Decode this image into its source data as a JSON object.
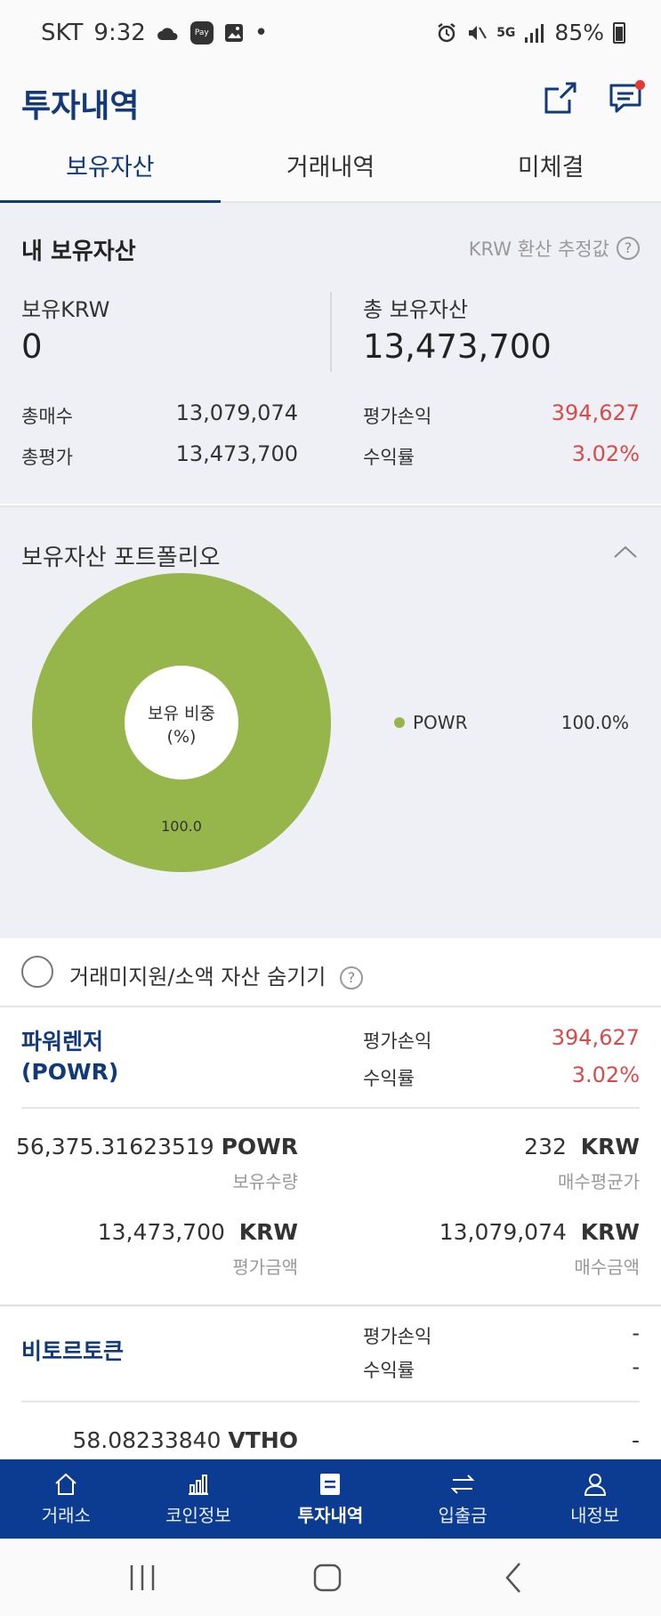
{
  "status_bar": {
    "carrier": "SKT",
    "time": "9:32",
    "pay": "Pay",
    "dot": "•",
    "net": "5G",
    "battery": "85%"
  },
  "header": {
    "title": "투자내역"
  },
  "tabs": [
    "보유자산",
    "거래내역",
    "미체결"
  ],
  "summary": {
    "title": "내 보유자산",
    "krw_note": "KRW 환산 추정값",
    "help": "?",
    "krw_label": "보유KRW",
    "krw_value": "0",
    "total_label": "총 보유자산",
    "total_value": "13,473,700",
    "buy_label": "총매수",
    "buy_value": "13,079,074",
    "eval_label": "총평가",
    "eval_value": "13,473,700",
    "pnl_label": "평가손익",
    "pnl_value": "394,627",
    "rate_label": "수익률",
    "rate_value": "3.02%"
  },
  "portfolio": {
    "title": "보유자산 포트폴리오",
    "center_line1": "보유 비중",
    "center_line2": "(%)",
    "legend_value": "100.0%",
    "accent_color": "#96b54a",
    "chart_data": {
      "type": "pie",
      "categories": [
        "POWR"
      ],
      "values": [
        100.0
      ],
      "labels": [
        "100.0"
      ]
    }
  },
  "hide_small": {
    "label": "거래미지원/소액 자산 숨기기",
    "help": "?"
  },
  "holdings": [
    {
      "name_line1": "파워렌저",
      "name_line2": "(POWR)",
      "pnl_label": "평가손익",
      "pnl_value": "394,627",
      "rate_label": "수익률",
      "rate_value": "3.02%",
      "qty": "56,375.31623519",
      "qty_unit": "POWR",
      "qty_label": "보유수량",
      "avg": "232",
      "avg_unit": "KRW",
      "avg_label": "매수평균가",
      "eval": "13,473,700",
      "eval_unit": "KRW",
      "eval_label": "평가금액",
      "buy": "13,079,074",
      "buy_unit": "KRW",
      "buy_label": "매수금액"
    },
    {
      "name_line1": "비토르토큰",
      "pnl_label": "평가손익",
      "pnl_value": "-",
      "rate_label": "수익률",
      "rate_value": "-",
      "qty": "58.08233840",
      "qty_unit": "VTHO",
      "avg": "-"
    }
  ],
  "bottom_nav": [
    {
      "label": "거래소",
      "icon": "home-icon"
    },
    {
      "label": "코인정보",
      "icon": "bar-chart-icon"
    },
    {
      "label": "투자내역",
      "icon": "document-icon"
    },
    {
      "label": "입출금",
      "icon": "transfer-icon"
    },
    {
      "label": "내정보",
      "icon": "person-icon"
    }
  ]
}
